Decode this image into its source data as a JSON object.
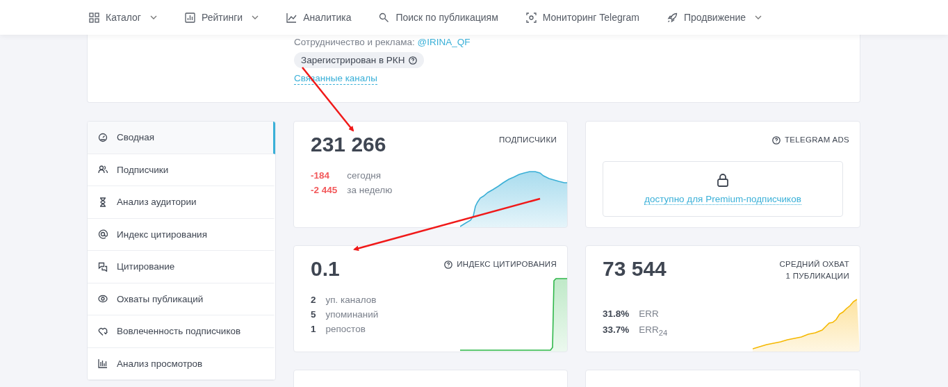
{
  "nav": [
    {
      "label": "Каталог",
      "dropdown": true
    },
    {
      "label": "Рейтинги",
      "dropdown": true
    },
    {
      "label": "Аналитика",
      "dropdown": false
    },
    {
      "label": "Поиск по публикациям",
      "dropdown": false
    },
    {
      "label": "Мониторинг Telegram",
      "dropdown": false
    },
    {
      "label": "Продвижение",
      "dropdown": true
    }
  ],
  "channel": {
    "contact_label": "Сотрудничество и реклама:",
    "contact_link": "@IRINA_QF",
    "badge": "Зарегистрирован в РКН",
    "related_link": "Связанные каналы"
  },
  "sidebar": {
    "items": [
      {
        "label": "Сводная",
        "selected": true
      },
      {
        "label": "Подписчики",
        "selected": false
      },
      {
        "label": "Анализ аудитории",
        "selected": false
      },
      {
        "label": "Индекс цитирования",
        "selected": false
      },
      {
        "label": "Цитирование",
        "selected": false
      },
      {
        "label": "Охваты публикаций",
        "selected": false
      },
      {
        "label": "Вовлеченность подписчиков",
        "selected": false
      },
      {
        "label": "Анализ просмотров",
        "selected": false
      }
    ]
  },
  "cards": [
    {
      "kind": "subscribers",
      "value": "231 266",
      "title": [
        "ПОДПИСЧИКИ"
      ],
      "info": false,
      "stats": [
        {
          "value": "-184",
          "label": "сегодня",
          "negative": true
        },
        {
          "value": "-2 445",
          "label": "за неделю",
          "negative": true
        }
      ]
    },
    {
      "kind": "locked",
      "title": [
        "TELEGRAM ADS"
      ],
      "info": true,
      "link": "доступно для Premium-подписчиков"
    },
    {
      "kind": "citations",
      "value": "0.1",
      "title": [
        "ИНДЕКС ЦИТИРОВАНИЯ"
      ],
      "info": true,
      "stats": [
        {
          "value": "2",
          "label": "уп. каналов",
          "negative": false
        },
        {
          "value": "5",
          "label": "упоминаний",
          "negative": false
        },
        {
          "value": "1",
          "label": "репостов",
          "negative": false
        }
      ]
    },
    {
      "kind": "reach",
      "value": "73 544",
      "title": [
        "СРЕДНИЙ ОХВАТ",
        "1 ПУБЛИКАЦИИ"
      ],
      "info": false,
      "stats": [
        {
          "value": "31.8%",
          "label": "ERR",
          "negative": false
        },
        {
          "value": "33.7%",
          "label": "ERR$_{24}$",
          "negative": false
        }
      ]
    },
    {
      "kind": "empty"
    },
    {
      "kind": "empty"
    }
  ]
}
